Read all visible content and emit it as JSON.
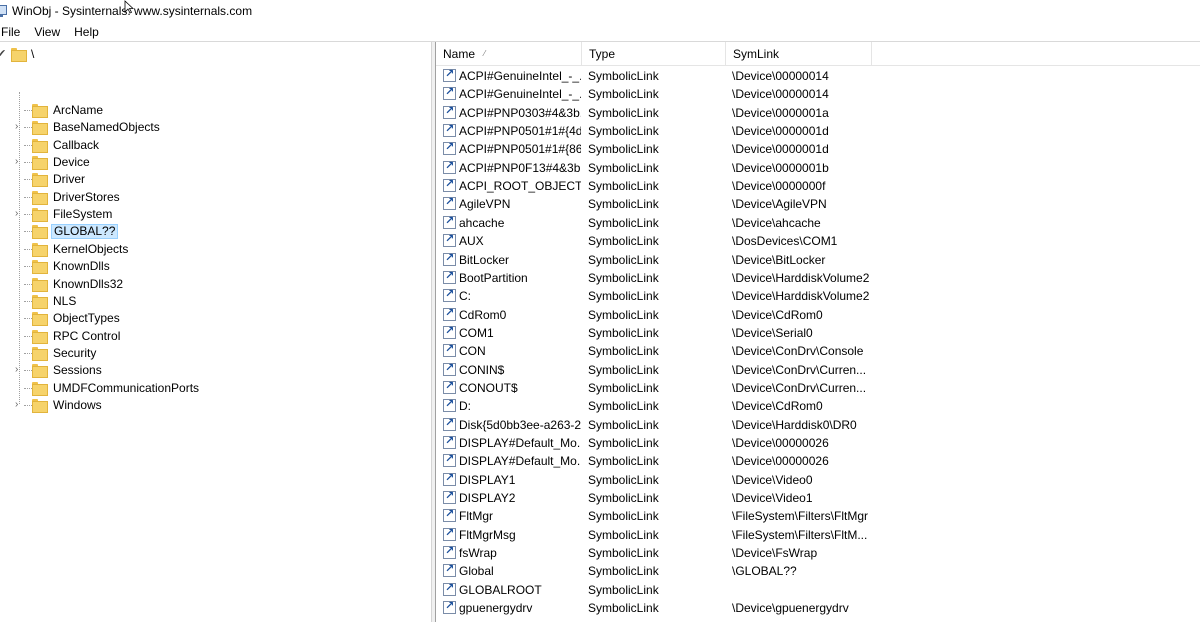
{
  "window": {
    "title": "WinObj - Sysinternals: www.sysinternals.com"
  },
  "menu": [
    "File",
    "View",
    "Help"
  ],
  "tree": {
    "root_label": "\\",
    "items": [
      {
        "label": "ArcName",
        "expandable": false,
        "selected": false
      },
      {
        "label": "BaseNamedObjects",
        "expandable": true,
        "selected": false
      },
      {
        "label": "Callback",
        "expandable": false,
        "selected": false
      },
      {
        "label": "Device",
        "expandable": true,
        "selected": false
      },
      {
        "label": "Driver",
        "expandable": false,
        "selected": false
      },
      {
        "label": "DriverStores",
        "expandable": false,
        "selected": false
      },
      {
        "label": "FileSystem",
        "expandable": true,
        "selected": false
      },
      {
        "label": "GLOBAL??",
        "expandable": false,
        "selected": true
      },
      {
        "label": "KernelObjects",
        "expandable": false,
        "selected": false
      },
      {
        "label": "KnownDlls",
        "expandable": false,
        "selected": false
      },
      {
        "label": "KnownDlls32",
        "expandable": false,
        "selected": false
      },
      {
        "label": "NLS",
        "expandable": false,
        "selected": false
      },
      {
        "label": "ObjectTypes",
        "expandable": false,
        "selected": false
      },
      {
        "label": "RPC Control",
        "expandable": false,
        "selected": false
      },
      {
        "label": "Security",
        "expandable": false,
        "selected": false
      },
      {
        "label": "Sessions",
        "expandable": true,
        "selected": false
      },
      {
        "label": "UMDFCommunicationPorts",
        "expandable": false,
        "selected": false
      },
      {
        "label": "Windows",
        "expandable": true,
        "selected": false
      }
    ]
  },
  "list": {
    "columns": {
      "name": "Name",
      "type": "Type",
      "symlink": "SymLink",
      "sort_glyph": "⁄"
    },
    "rows": [
      {
        "name": "ACPI#GenuineIntel_-_...",
        "type": "SymbolicLink",
        "symlink": "\\Device\\00000014"
      },
      {
        "name": "ACPI#GenuineIntel_-_...",
        "type": "SymbolicLink",
        "symlink": "\\Device\\00000014"
      },
      {
        "name": "ACPI#PNP0303#4&3b...",
        "type": "SymbolicLink",
        "symlink": "\\Device\\0000001a"
      },
      {
        "name": "ACPI#PNP0501#1#{4d...",
        "type": "SymbolicLink",
        "symlink": "\\Device\\0000001d"
      },
      {
        "name": "ACPI#PNP0501#1#{86...",
        "type": "SymbolicLink",
        "symlink": "\\Device\\0000001d"
      },
      {
        "name": "ACPI#PNP0F13#4&3b...",
        "type": "SymbolicLink",
        "symlink": "\\Device\\0000001b"
      },
      {
        "name": "ACPI_ROOT_OBJECT",
        "type": "SymbolicLink",
        "symlink": "\\Device\\0000000f"
      },
      {
        "name": "AgileVPN",
        "type": "SymbolicLink",
        "symlink": "\\Device\\AgileVPN"
      },
      {
        "name": "ahcache",
        "type": "SymbolicLink",
        "symlink": "\\Device\\ahcache"
      },
      {
        "name": "AUX",
        "type": "SymbolicLink",
        "symlink": "\\DosDevices\\COM1"
      },
      {
        "name": "BitLocker",
        "type": "SymbolicLink",
        "symlink": "\\Device\\BitLocker"
      },
      {
        "name": "BootPartition",
        "type": "SymbolicLink",
        "symlink": "\\Device\\HarddiskVolume2"
      },
      {
        "name": "C:",
        "type": "SymbolicLink",
        "symlink": "\\Device\\HarddiskVolume2"
      },
      {
        "name": "CdRom0",
        "type": "SymbolicLink",
        "symlink": "\\Device\\CdRom0"
      },
      {
        "name": "COM1",
        "type": "SymbolicLink",
        "symlink": "\\Device\\Serial0"
      },
      {
        "name": "CON",
        "type": "SymbolicLink",
        "symlink": "\\Device\\ConDrv\\Console"
      },
      {
        "name": "CONIN$",
        "type": "SymbolicLink",
        "symlink": "\\Device\\ConDrv\\Curren..."
      },
      {
        "name": "CONOUT$",
        "type": "SymbolicLink",
        "symlink": "\\Device\\ConDrv\\Curren..."
      },
      {
        "name": "D:",
        "type": "SymbolicLink",
        "symlink": "\\Device\\CdRom0"
      },
      {
        "name": "Disk{5d0bb3ee-a263-2...",
        "type": "SymbolicLink",
        "symlink": "\\Device\\Harddisk0\\DR0"
      },
      {
        "name": "DISPLAY#Default_Mo...",
        "type": "SymbolicLink",
        "symlink": "\\Device\\00000026"
      },
      {
        "name": "DISPLAY#Default_Mo...",
        "type": "SymbolicLink",
        "symlink": "\\Device\\00000026"
      },
      {
        "name": "DISPLAY1",
        "type": "SymbolicLink",
        "symlink": "\\Device\\Video0"
      },
      {
        "name": "DISPLAY2",
        "type": "SymbolicLink",
        "symlink": "\\Device\\Video1"
      },
      {
        "name": "FltMgr",
        "type": "SymbolicLink",
        "symlink": "\\FileSystem\\Filters\\FltMgr"
      },
      {
        "name": "FltMgrMsg",
        "type": "SymbolicLink",
        "symlink": "\\FileSystem\\Filters\\FltM..."
      },
      {
        "name": "fsWrap",
        "type": "SymbolicLink",
        "symlink": "\\Device\\FsWrap"
      },
      {
        "name": "Global",
        "type": "SymbolicLink",
        "symlink": "\\GLOBAL??"
      },
      {
        "name": "GLOBALROOT",
        "type": "SymbolicLink",
        "symlink": ""
      },
      {
        "name": "gpuenergydrv",
        "type": "SymbolicLink",
        "symlink": "\\Device\\gpuenergydrv"
      }
    ]
  }
}
